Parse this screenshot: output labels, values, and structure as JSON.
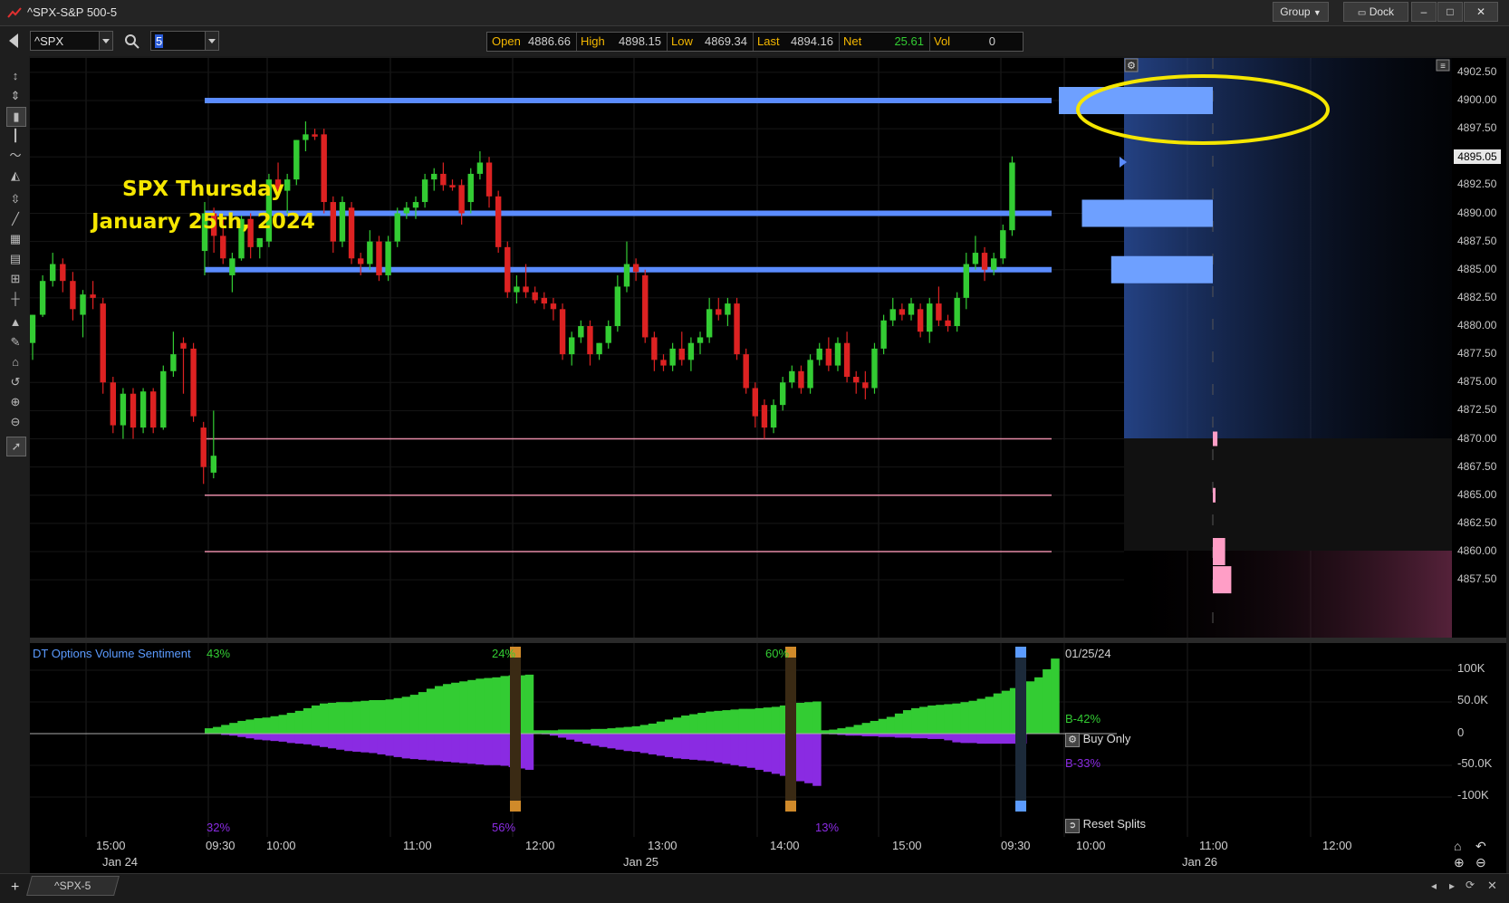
{
  "window": {
    "title": "^SPX-S&P 500-5",
    "group_label": "Group",
    "dock_label": "Dock"
  },
  "toolbar": {
    "symbol": "^SPX",
    "interval": "5"
  },
  "quote": {
    "open_label": "Open",
    "open": "4886.66",
    "high_label": "High",
    "high": "4898.15",
    "low_label": "Low",
    "low": "4869.34",
    "last_label": "Last",
    "last": "4894.16",
    "net_label": "Net",
    "net": "25.61",
    "vol_label": "Vol",
    "vol": "0"
  },
  "annotation": {
    "line1": "SPX Thursday",
    "line2": "January 25th, 2024",
    "highlight_color": "#f5e600"
  },
  "price_axis": {
    "labels": [
      "4902.50",
      "4900.00",
      "4897.50",
      "4895.05",
      "4892.50",
      "4890.00",
      "4887.50",
      "4885.00",
      "4882.50",
      "4880.00",
      "4877.50",
      "4875.00",
      "4872.50",
      "4870.00",
      "4867.50",
      "4865.00",
      "4862.50",
      "4860.00",
      "4857.50"
    ],
    "current_price": "4895.05"
  },
  "indicator": {
    "name": "DT Options Volume Sentiment",
    "segments_top": [
      "43%",
      "24%",
      "60%"
    ],
    "segments_bottom": [
      "32%",
      "56%",
      "13%"
    ],
    "date": "01/25/24",
    "buy_pct": "B-42%",
    "sell_pct": "B-33%",
    "buy_only_label": "Buy Only",
    "reset_splits_label": "Reset Splits",
    "axis_labels": [
      "100K",
      "50.0K",
      "0",
      "-50.0K",
      "-100K"
    ],
    "colors": {
      "buy": "#33cc33",
      "sell": "#8a2be2"
    }
  },
  "time_axis": {
    "ticks": [
      "15:00",
      "09:30",
      "10:00",
      "11:00",
      "12:00",
      "13:00",
      "14:00",
      "15:00",
      "09:30",
      "10:00",
      "11:00",
      "12:00"
    ],
    "dates": [
      "Jan 24",
      "Jan 25",
      "Jan 26"
    ]
  },
  "footer": {
    "tab_label": "^SPX-5"
  },
  "colors": {
    "up": "#33cc33",
    "down": "#dd2222",
    "level_line": "#5b8cff",
    "pink_line": "#e48aa6"
  },
  "chart_data": {
    "type": "candlestick",
    "interval_minutes": 5,
    "levels": [
      4900.0,
      4890.0,
      4885.0,
      4870.0,
      4865.0,
      4860.0
    ],
    "candles": [
      [
        "Jan 24 15:05",
        4878.5,
        4881.0,
        4877.0,
        4881.0
      ],
      [
        "Jan 24 15:10",
        4881.0,
        4884.5,
        4880.8,
        4884.0
      ],
      [
        "Jan 24 15:15",
        4884.0,
        4886.5,
        4883.5,
        4885.5
      ],
      [
        "Jan 24 15:20",
        4885.5,
        4886.0,
        4883.0,
        4884.0
      ],
      [
        "Jan 24 15:25",
        4884.0,
        4884.8,
        4880.5,
        4881.5
      ],
      [
        "Jan 24 15:30",
        4881.0,
        4883.2,
        4879.0,
        4882.8
      ],
      [
        "Jan 24 15:35",
        4882.8,
        4884.0,
        4881.5,
        4882.5
      ],
      [
        "Jan 24 15:40",
        4882.0,
        4882.5,
        4874.0,
        4875.0
      ],
      [
        "Jan 24 15:45",
        4875.0,
        4875.5,
        4870.5,
        4871.2
      ],
      [
        "Jan 24 15:50",
        4871.2,
        4874.5,
        4870.0,
        4874.0
      ],
      [
        "Jan 24 15:55",
        4874.0,
        4874.5,
        4870.0,
        4871.0
      ],
      [
        "Jan 24 16:00",
        4871.0,
        4874.5,
        4870.5,
        4874.2
      ],
      [
        "Jan 24 16:05",
        4874.2,
        4874.5,
        4870.5,
        4871.0
      ],
      [
        "Jan 24 16:10",
        4871.0,
        4876.5,
        4870.8,
        4876.0
      ],
      [
        "Jan 24 16:15",
        4876.0,
        4879.5,
        4875.5,
        4877.5
      ],
      [
        "Jan 24 16:20",
        4878.5,
        4879.0,
        4874.0,
        4878.0
      ],
      [
        "Jan 24 16:25",
        4878.0,
        4878.5,
        4871.5,
        4872.0
      ],
      [
        "Jan 24 16:30",
        4871.0,
        4871.5,
        4866.0,
        4867.5
      ],
      [
        "Jan 24 16:35",
        4867.0,
        4872.5,
        4866.5,
        4868.5
      ],
      [
        "Jan 25 09:30",
        4886.66,
        4891.0,
        4884.5,
        4890.0
      ],
      [
        "Jan 25 09:35",
        4890.0,
        4890.5,
        4886.5,
        4888.0
      ],
      [
        "Jan 25 09:40",
        4888.0,
        4889.5,
        4885.5,
        4886.0
      ],
      [
        "Jan 25 09:45",
        4884.5,
        4886.5,
        4883.0,
        4886.0
      ],
      [
        "Jan 25 09:50",
        4886.0,
        4889.8,
        4885.8,
        4889.5
      ],
      [
        "Jan 25 09:55",
        4889.5,
        4890.0,
        4886.0,
        4887.0
      ],
      [
        "Jan 25 10:00",
        4887.0,
        4887.5,
        4886.0,
        4887.8
      ],
      [
        "Jan 25 10:05",
        4887.5,
        4893.5,
        4887.0,
        4893.0
      ],
      [
        "Jan 25 10:10",
        4893.0,
        4894.5,
        4891.5,
        4892.0
      ],
      [
        "Jan 25 10:15",
        4892.0,
        4893.5,
        4890.0,
        4893.0
      ],
      [
        "Jan 25 10:20",
        4893.0,
        4896.5,
        4892.5,
        4896.5
      ],
      [
        "Jan 25 10:25",
        4896.5,
        4898.15,
        4895.5,
        4897.0
      ],
      [
        "Jan 25 10:30",
        4897.0,
        4897.5,
        4896.5,
        4896.8
      ],
      [
        "Jan 25 10:35",
        4897.0,
        4897.5,
        4890.0,
        4891.0
      ],
      [
        "Jan 25 10:40",
        4891.0,
        4891.5,
        4886.5,
        4887.5
      ],
      [
        "Jan 25 10:45",
        4887.5,
        4891.5,
        4887.0,
        4891.0
      ],
      [
        "Jan 25 10:50",
        4890.5,
        4891.0,
        4885.5,
        4886.0
      ],
      [
        "Jan 25 10:55",
        4886.0,
        4886.5,
        4884.5,
        4885.5
      ],
      [
        "Jan 25 11:00",
        4885.5,
        4888.5,
        4885.0,
        4887.5
      ],
      [
        "Jan 25 11:05",
        4887.5,
        4888.0,
        4884.0,
        4884.5
      ],
      [
        "Jan 25 11:10",
        4884.5,
        4888.0,
        4884.0,
        4887.5
      ],
      [
        "Jan 25 11:15",
        4887.5,
        4890.5,
        4887.0,
        4890.0
      ],
      [
        "Jan 25 11:20",
        4890.0,
        4891.0,
        4889.5,
        4890.5
      ],
      [
        "Jan 25 11:25",
        4890.5,
        4891.5,
        4889.5,
        4891.0
      ],
      [
        "Jan 25 11:30",
        4891.0,
        4893.5,
        4890.5,
        4893.0
      ],
      [
        "Jan 25 11:35",
        4893.0,
        4894.0,
        4892.0,
        4893.5
      ],
      [
        "Jan 25 11:40",
        4893.5,
        4894.5,
        4892.0,
        4892.5
      ],
      [
        "Jan 25 11:45",
        4892.5,
        4893.0,
        4892.0,
        4892.3
      ],
      [
        "Jan 25 11:50",
        4892.5,
        4893.0,
        4889.0,
        4890.0
      ],
      [
        "Jan 25 11:55",
        4891.0,
        4894.0,
        4890.0,
        4893.5
      ],
      [
        "Jan 25 12:00",
        4893.5,
        4895.5,
        4893.0,
        4894.5
      ],
      [
        "Jan 25 12:05",
        4894.5,
        4895.0,
        4890.5,
        4891.5
      ],
      [
        "Jan 25 12:10",
        4891.5,
        4892.0,
        4886.5,
        4887.0
      ],
      [
        "Jan 25 12:15",
        4887.0,
        4887.5,
        4882.5,
        4883.0
      ],
      [
        "Jan 25 12:20",
        4883.0,
        4884.5,
        4882.0,
        4883.5
      ],
      [
        "Jan 25 12:25",
        4883.5,
        4885.5,
        4882.5,
        4883.0
      ],
      [
        "Jan 25 12:30",
        4883.0,
        4883.5,
        4882.0,
        4882.3
      ],
      [
        "Jan 25 12:35",
        4882.5,
        4883.0,
        4881.5,
        4882.0
      ],
      [
        "Jan 25 12:40",
        4882.0,
        4882.5,
        4880.5,
        4881.5
      ],
      [
        "Jan 25 12:45",
        4881.5,
        4882.0,
        4877.0,
        4877.5
      ],
      [
        "Jan 25 12:50",
        4877.5,
        4879.5,
        4876.5,
        4879.0
      ],
      [
        "Jan 25 12:55",
        4879.0,
        4880.5,
        4878.5,
        4880.0
      ],
      [
        "Jan 25 13:00",
        4880.0,
        4880.5,
        4876.5,
        4877.5
      ],
      [
        "Jan 25 13:05",
        4877.5,
        4878.5,
        4877.0,
        4878.5
      ],
      [
        "Jan 25 13:10",
        4878.5,
        4880.5,
        4878.0,
        4880.0
      ],
      [
        "Jan 25 13:15",
        4880.0,
        4884.5,
        4879.5,
        4883.5
      ],
      [
        "Jan 25 13:20",
        4883.5,
        4887.5,
        4883.0,
        4885.5
      ],
      [
        "Jan 25 13:25",
        4885.5,
        4886.0,
        4884.0,
        4884.8
      ],
      [
        "Jan 25 13:30",
        4884.5,
        4885.0,
        4878.5,
        4879.0
      ],
      [
        "Jan 25 13:35",
        4879.0,
        4879.5,
        4876.0,
        4877.0
      ],
      [
        "Jan 25 13:40",
        4877.0,
        4877.5,
        4876.0,
        4876.5
      ],
      [
        "Jan 25 13:45",
        4876.5,
        4878.5,
        4876.0,
        4878.0
      ],
      [
        "Jan 25 13:50",
        4878.0,
        4879.5,
        4876.5,
        4877.0
      ],
      [
        "Jan 25 13:55",
        4877.0,
        4879.0,
        4876.0,
        4878.5
      ],
      [
        "Jan 25 14:00",
        4878.5,
        4879.5,
        4877.5,
        4879.0
      ],
      [
        "Jan 25 14:05",
        4879.0,
        4882.5,
        4878.5,
        4881.5
      ],
      [
        "Jan 25 14:10",
        4881.5,
        4882.5,
        4880.5,
        4881.0
      ],
      [
        "Jan 25 14:15",
        4881.0,
        4882.5,
        4880.0,
        4882.0
      ],
      [
        "Jan 25 14:20",
        4882.0,
        4882.5,
        4877.0,
        4877.5
      ],
      [
        "Jan 25 14:25",
        4877.5,
        4878.0,
        4874.0,
        4874.5
      ],
      [
        "Jan 25 14:30",
        4874.5,
        4875.0,
        4871.0,
        4872.0
      ],
      [
        "Jan 25 14:35",
        4873.0,
        4873.5,
        4870.0,
        4871.0
      ],
      [
        "Jan 25 14:40",
        4871.0,
        4873.5,
        4870.5,
        4873.0
      ],
      [
        "Jan 25 14:45",
        4873.0,
        4875.5,
        4872.5,
        4875.0
      ],
      [
        "Jan 25 14:50",
        4875.0,
        4876.5,
        4874.5,
        4876.0
      ],
      [
        "Jan 25 14:55",
        4876.0,
        4876.5,
        4874.0,
        4874.5
      ],
      [
        "Jan 25 15:00",
        4874.5,
        4877.5,
        4874.0,
        4877.0
      ],
      [
        "Jan 25 15:05",
        4877.0,
        4878.5,
        4876.5,
        4878.0
      ],
      [
        "Jan 25 15:10",
        4878.0,
        4879.0,
        4876.0,
        4876.5
      ],
      [
        "Jan 25 15:15",
        4876.5,
        4879.0,
        4876.0,
        4878.5
      ],
      [
        "Jan 25 15:20",
        4878.5,
        4879.5,
        4875.0,
        4875.5
      ],
      [
        "Jan 25 15:25",
        4875.5,
        4876.0,
        4874.0,
        4875.0
      ],
      [
        "Jan 25 15:30",
        4875.0,
        4876.0,
        4873.5,
        4874.5
      ],
      [
        "Jan 25 15:35",
        4874.5,
        4878.5,
        4874.0,
        4878.0
      ],
      [
        "Jan 25 15:40",
        4878.0,
        4881.0,
        4877.5,
        4880.5
      ],
      [
        "Jan 25 15:45",
        4880.5,
        4882.5,
        4880.0,
        4881.5
      ],
      [
        "Jan 25 15:50",
        4881.5,
        4882.0,
        4880.5,
        4881.0
      ],
      [
        "Jan 25 15:55",
        4881.0,
        4882.5,
        4880.5,
        4882.0
      ],
      [
        "Jan 25 16:00",
        4881.5,
        4882.0,
        4879.0,
        4879.5
      ],
      [
        "Jan 25 16:05",
        4879.5,
        4882.5,
        4878.5,
        4882.0
      ],
      [
        "Jan 25 16:10",
        4882.0,
        4883.5,
        4880.0,
        4880.5
      ],
      [
        "Jan 25 16:15",
        4880.5,
        4881.0,
        4879.5,
        4880.0
      ],
      [
        "Jan 25 16:20",
        4880.0,
        4883.0,
        4879.5,
        4882.5
      ],
      [
        "Jan 25 16:25",
        4882.5,
        4886.5,
        4881.5,
        4885.5
      ],
      [
        "Jan 25 16:30",
        4885.5,
        4888.0,
        4885.0,
        4886.5
      ],
      [
        "Jan 25 16:35",
        4886.5,
        4887.0,
        4884.0,
        4885.0
      ],
      [
        "Jan 25 16:40",
        4885.0,
        4886.5,
        4884.5,
        4886.0
      ],
      [
        "Jan 25 16:45",
        4886.0,
        4889.0,
        4885.5,
        4888.5
      ],
      [
        "Jan 25 16:50",
        4888.5,
        4895.05,
        4888.0,
        4894.5
      ]
    ],
    "volume_profile": [
      {
        "price": 4900.0,
        "size": 1.0,
        "color": "#6ea0ff"
      },
      {
        "price": 4890.0,
        "size": 0.85,
        "color": "#6ea0ff"
      },
      {
        "price": 4885.0,
        "size": 0.66,
        "color": "#6ea0ff"
      },
      {
        "price": 4870.0,
        "size": 0.03,
        "color": "#ff9ec6"
      },
      {
        "price": 4865.0,
        "size": 0.01,
        "color": "#ff9ec6"
      },
      {
        "price": 4860.0,
        "size": 0.08,
        "color": "#ff9ec6"
      },
      {
        "price": 4857.5,
        "size": 0.12,
        "color": "#ff9ec6"
      }
    ],
    "sentiment": {
      "buy": [
        8,
        10,
        13,
        16,
        19,
        21,
        23,
        24,
        26,
        28,
        31,
        34,
        38,
        42,
        45,
        46,
        47,
        47,
        48,
        49,
        50,
        50,
        51,
        53,
        55,
        58,
        62,
        67,
        71,
        74,
        76,
        78,
        80,
        82,
        83,
        84,
        86,
        87,
        87,
        88,
        5,
        5,
        5,
        6,
        6,
        6,
        6,
        7,
        7,
        8,
        9,
        10,
        11,
        13,
        15,
        18,
        21,
        24,
        27,
        29,
        31,
        33,
        34,
        35,
        36,
        37,
        37,
        38,
        39,
        40,
        42,
        44,
        46,
        47,
        48,
        5,
        6,
        8,
        10,
        13,
        16,
        19,
        22,
        25,
        30,
        35,
        38,
        40,
        42,
        43,
        44,
        45,
        47,
        49,
        52,
        55,
        60,
        64,
        68,
        73,
        78,
        84,
        96,
        112
      ],
      "sell": [
        0,
        0,
        2,
        3,
        5,
        7,
        9,
        10,
        11,
        12,
        14,
        15,
        16,
        18,
        20,
        22,
        24,
        26,
        27,
        28,
        29,
        31,
        33,
        35,
        37,
        38,
        39,
        40,
        41,
        42,
        43,
        44,
        45,
        46,
        47,
        47,
        48,
        50,
        52,
        54,
        0,
        1,
        3,
        6,
        9,
        12,
        15,
        18,
        20,
        22,
        24,
        26,
        27,
        29,
        31,
        33,
        35,
        37,
        38,
        39,
        40,
        41,
        43,
        45,
        47,
        49,
        51,
        54,
        57,
        60,
        63,
        67,
        71,
        74,
        78,
        0,
        1,
        2,
        3,
        3,
        4,
        4,
        5,
        5,
        6,
        6,
        7,
        7,
        8,
        8,
        10,
        13,
        14,
        14,
        15,
        15,
        15,
        15,
        15,
        15
      ]
    }
  }
}
